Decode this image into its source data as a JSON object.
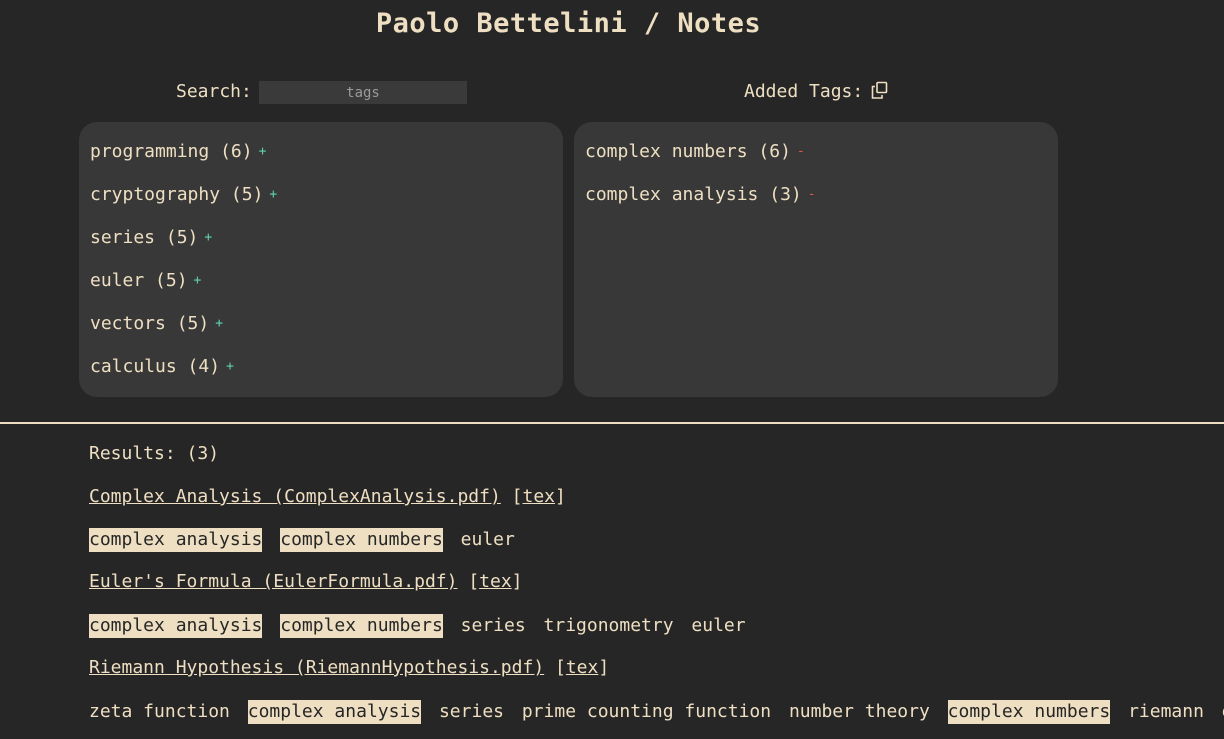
{
  "header": {
    "title": "Paolo Bettelini / Notes"
  },
  "search": {
    "label": "Search:",
    "placeholder": "tags",
    "value": ""
  },
  "added": {
    "label": "Added Tags:",
    "copy_icon": "copy-icon"
  },
  "available_tags": [
    {
      "name": "programming",
      "count": "(6)",
      "action": "+"
    },
    {
      "name": "cryptography",
      "count": "(5)",
      "action": "+"
    },
    {
      "name": "series",
      "count": "(5)",
      "action": "+"
    },
    {
      "name": "euler",
      "count": "(5)",
      "action": "+"
    },
    {
      "name": "vectors",
      "count": "(5)",
      "action": "+"
    },
    {
      "name": "calculus",
      "count": "(4)",
      "action": "+"
    }
  ],
  "added_tags": [
    {
      "name": "complex numbers",
      "count": "(6)",
      "action": "-"
    },
    {
      "name": "complex analysis",
      "count": "(3)",
      "action": "-"
    }
  ],
  "results": {
    "label": "Results: (3)",
    "items": [
      {
        "title": "Complex Analysis (ComplexAnalysis.pdf)",
        "tex": "tex",
        "tags": [
          {
            "text": "complex analysis",
            "highlight": true
          },
          {
            "text": "complex numbers",
            "highlight": true
          },
          {
            "text": "euler",
            "highlight": false
          }
        ]
      },
      {
        "title": "Euler's Formula (EulerFormula.pdf)",
        "tex": "tex",
        "tags": [
          {
            "text": "complex analysis",
            "highlight": true
          },
          {
            "text": "complex numbers",
            "highlight": true
          },
          {
            "text": "series",
            "highlight": false
          },
          {
            "text": "trigonometry",
            "highlight": false
          },
          {
            "text": "euler",
            "highlight": false
          }
        ]
      },
      {
        "title": "Riemann Hypothesis (RiemannHypothesis.pdf)",
        "tex": "tex",
        "tags": [
          {
            "text": "zeta function",
            "highlight": false
          },
          {
            "text": "complex analysis",
            "highlight": true
          },
          {
            "text": "series",
            "highlight": false
          },
          {
            "text": "prime counting function",
            "highlight": false
          },
          {
            "text": "number theory",
            "highlight": false
          },
          {
            "text": "complex numbers",
            "highlight": true
          },
          {
            "text": "riemann",
            "highlight": false
          },
          {
            "text": "euler",
            "highlight": false
          }
        ]
      }
    ]
  }
}
